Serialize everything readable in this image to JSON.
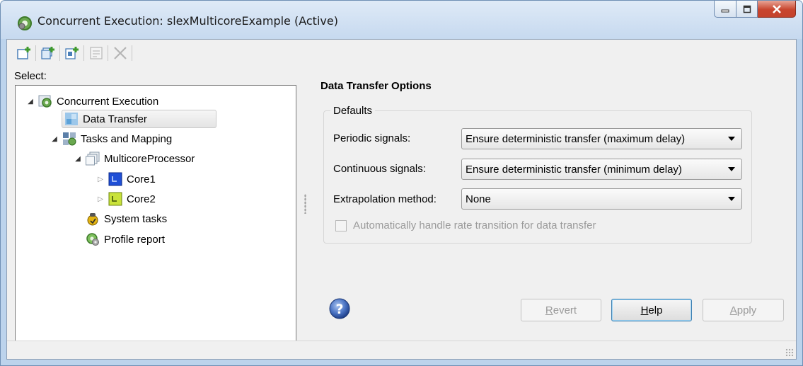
{
  "window": {
    "title": "Concurrent Execution: slexMulticoreExample (Active)"
  },
  "toolbar": {
    "buttons": [
      {
        "icon": "add-task-icon"
      },
      {
        "icon": "add-group-icon"
      },
      {
        "icon": "add-core-icon"
      },
      {
        "icon": "properties-icon",
        "disabled": true
      },
      {
        "icon": "delete-icon",
        "disabled": true
      }
    ]
  },
  "tree": {
    "label": "Select:",
    "items": [
      {
        "label": "Concurrent Execution",
        "icon": "concurrent-execution-icon",
        "level": 0,
        "expander": "expanded"
      },
      {
        "label": "Data Transfer",
        "icon": "data-transfer-icon",
        "level": 1,
        "expander": "none",
        "selected": true
      },
      {
        "label": "Tasks and Mapping",
        "icon": "tasks-mapping-icon",
        "level": 1,
        "expander": "expanded"
      },
      {
        "label": "MulticoreProcessor",
        "icon": "processor-icon",
        "level": 2,
        "expander": "expanded"
      },
      {
        "label": "Core1",
        "icon": "core1-icon",
        "level": 3,
        "expander": "collapsed"
      },
      {
        "label": "Core2",
        "icon": "core2-icon",
        "level": 3,
        "expander": "collapsed"
      },
      {
        "label": "System tasks",
        "icon": "system-tasks-icon",
        "level": 2,
        "expander": "none"
      },
      {
        "label": "Profile report",
        "icon": "profile-report-icon",
        "level": 2,
        "expander": "none"
      }
    ]
  },
  "panel": {
    "title": "Data Transfer Options",
    "group_title": "Defaults",
    "periodic_label": "Periodic signals:",
    "periodic_value": "Ensure deterministic transfer (maximum delay)",
    "continuous_label": "Continuous signals:",
    "continuous_value": "Ensure deterministic transfer (minimum delay)",
    "extrapolation_label": "Extrapolation method:",
    "extrapolation_value": "None",
    "checkbox_label": "Automatically handle rate transition for data transfer",
    "checkbox_checked": false
  },
  "buttons": {
    "revert_first": "R",
    "revert_rest": "evert",
    "help_first": "H",
    "help_rest": "elp",
    "apply_first": "A",
    "apply_rest": "pply"
  }
}
